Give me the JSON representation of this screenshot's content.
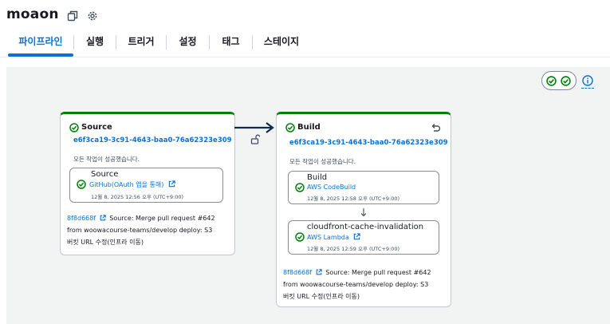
{
  "pipeline": {
    "name": "moaon"
  },
  "header": {
    "copy_icon": "copy-icon",
    "settings_icon": "gear-icon"
  },
  "tabs": [
    {
      "label": "파이프라인",
      "active": true
    },
    {
      "label": "실행"
    },
    {
      "label": "트리거"
    },
    {
      "label": "설정"
    },
    {
      "label": "태그"
    },
    {
      "label": "스테이지"
    }
  ],
  "colors": {
    "accent": "#0972d3",
    "success": "#037f0c",
    "canvas": "#f2f3f3",
    "arrow": "#0f2b4a"
  },
  "toolbar": {
    "status_icons": [
      "success-check-icon",
      "success-check-icon"
    ],
    "info_icon": "info-icon"
  },
  "stages": {
    "source": {
      "title": "Source",
      "execution_id": "e6f3ca19-3c91-4643-baa0-76a62323e309",
      "message": "모든 작업이 성공했습니다.",
      "actions": [
        {
          "name": "Source",
          "provider": "GitHub(OAuth 앱을 통해)",
          "time": "12월 8, 2025 12:56 오후 (UTC+9:00)"
        }
      ],
      "commit": {
        "id": "8f8d668f",
        "line1": "Source: Merge pull request #642",
        "line2": "from woowacourse-teams/develop deploy: S3",
        "line3": "버킷 URL 수정(인프라 이동)"
      }
    },
    "build": {
      "title": "Build",
      "execution_id": "e6f3ca19-3c91-4643-baa0-76a62323e309",
      "message": "모든 작업이 성공했습니다.",
      "actions": [
        {
          "name": "Build",
          "provider": "AWS CodeBuild",
          "time": "12월 8, 2025 12:58 오후 (UTC+9:00)"
        },
        {
          "name": "cloudfront-cache-invalidation",
          "provider": "AWS Lambda",
          "time": "12월 8, 2025 12:59 오후 (UTC+9:00)"
        }
      ],
      "commit": {
        "id": "8f8d668f",
        "line1": "Source: Merge pull request #642",
        "line2": "from woowacourse-teams/develop deploy: S3",
        "line3": "버킷 URL 수정(인프라 이동)"
      }
    }
  },
  "transition": {
    "lock_icon": "unlock-icon",
    "arrow_icon": "arrow-right-icon"
  }
}
